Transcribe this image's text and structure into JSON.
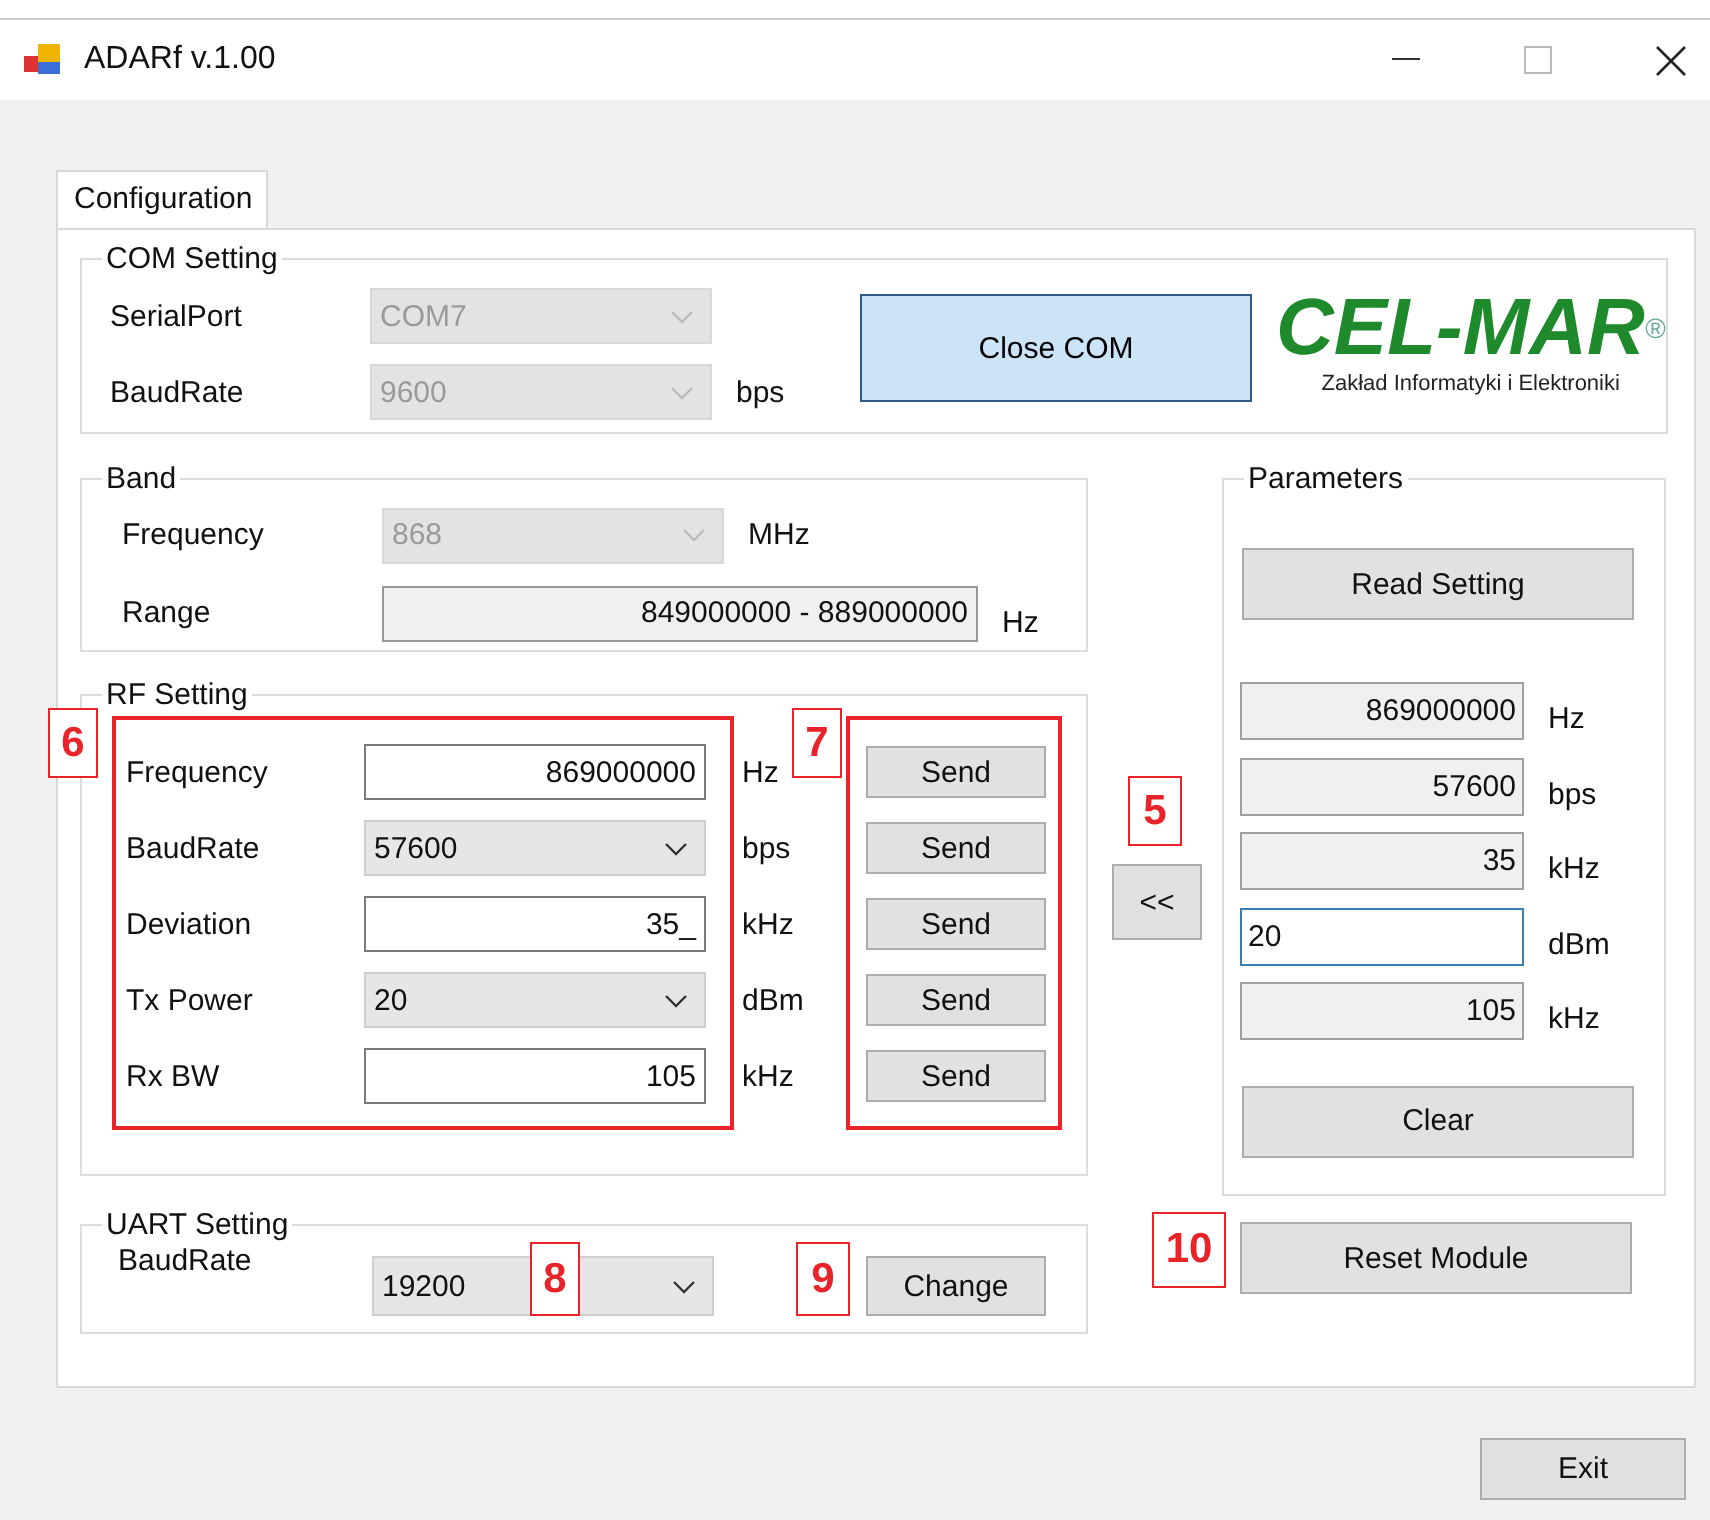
{
  "window": {
    "title": "ADARf v.1.00"
  },
  "tabs": [
    {
      "label": "Configuration",
      "selected": true
    }
  ],
  "com_setting": {
    "title": "COM Setting",
    "fields": [
      {
        "label": "SerialPort",
        "value": "COM7",
        "disabled": true
      },
      {
        "label": "BaudRate",
        "value": "9600",
        "disabled": true,
        "unit": "bps"
      }
    ],
    "button": "Close COM"
  },
  "logo": {
    "name": "CEL-MAR$^{®}$",
    "tagline": "Zakład Informatyki i Elektroniki"
  },
  "band": {
    "title": "Band",
    "rows": [
      {
        "label": "Frequency",
        "kind": "select",
        "value": "868",
        "disabled": true,
        "unit": "MHz"
      },
      {
        "label": "Range",
        "kind": "readonly",
        "value": "849000000 - 889000000",
        "unit": "Hz"
      }
    ]
  },
  "rf_setting": {
    "title": "RF Setting",
    "fields_callout": "6",
    "send_callout": "7",
    "rows": [
      {
        "label": "Frequency",
        "kind": "text",
        "value": "869000000",
        "unit": "Hz",
        "button": "Send"
      },
      {
        "label": "BaudRate",
        "kind": "select",
        "value": "57600",
        "unit": "bps",
        "button": "Send"
      },
      {
        "label": "Deviation",
        "kind": "text",
        "value": "35_",
        "unit": "kHz",
        "button": "Send"
      },
      {
        "label": "Tx Power",
        "kind": "select",
        "value": "20",
        "unit": "dBm",
        "button": "Send"
      },
      {
        "label": "Rx BW",
        "kind": "text",
        "value": "105",
        "unit": "kHz",
        "button": "Send"
      }
    ]
  },
  "uart_setting": {
    "title": "UART Setting",
    "label": "BaudRate",
    "value": "19200",
    "select_callout": "8",
    "button": "Change",
    "button_callout": "9"
  },
  "copy_button": {
    "label": "<<",
    "callout": "5"
  },
  "parameters": {
    "title": "Parameters",
    "read_button": "Read Setting",
    "rows": [
      {
        "value": "869000000",
        "unit": "Hz",
        "focused": false
      },
      {
        "value": "57600",
        "unit": "bps",
        "focused": false
      },
      {
        "value": "35",
        "unit": "kHz",
        "focused": false
      },
      {
        "value": "20",
        "unit": "dBm",
        "focused": true
      },
      {
        "value": "105",
        "unit": "kHz",
        "focused": false
      }
    ],
    "clear_button": "Clear"
  },
  "reset_button": {
    "label": "Reset Module",
    "callout": "10"
  },
  "exit_button": "Exit"
}
